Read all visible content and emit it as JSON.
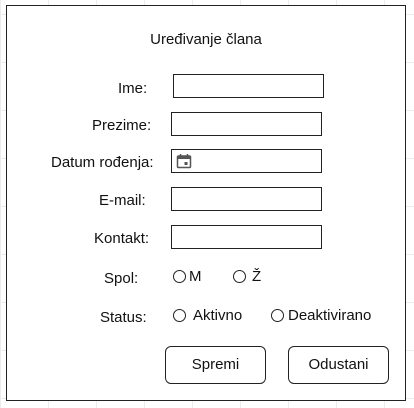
{
  "dialog": {
    "title": "Uređivanje člana"
  },
  "form": {
    "ime_label": "Ime:",
    "ime_value": "",
    "prezime_label": "Prezime:",
    "prezime_value": "",
    "datum_label": "Datum rođenja:",
    "datum_value": "",
    "datum_icon": "calendar-icon",
    "email_label": "E-mail:",
    "email_value": "",
    "kontakt_label": "Kontakt:",
    "kontakt_value": ""
  },
  "spol": {
    "label": "Spol:",
    "options": [
      "M",
      "Ž"
    ]
  },
  "status": {
    "label": "Status:",
    "options": [
      "Aktivno",
      "Deaktivirano"
    ]
  },
  "buttons": {
    "save": "Spremi",
    "cancel": "Odustani"
  }
}
